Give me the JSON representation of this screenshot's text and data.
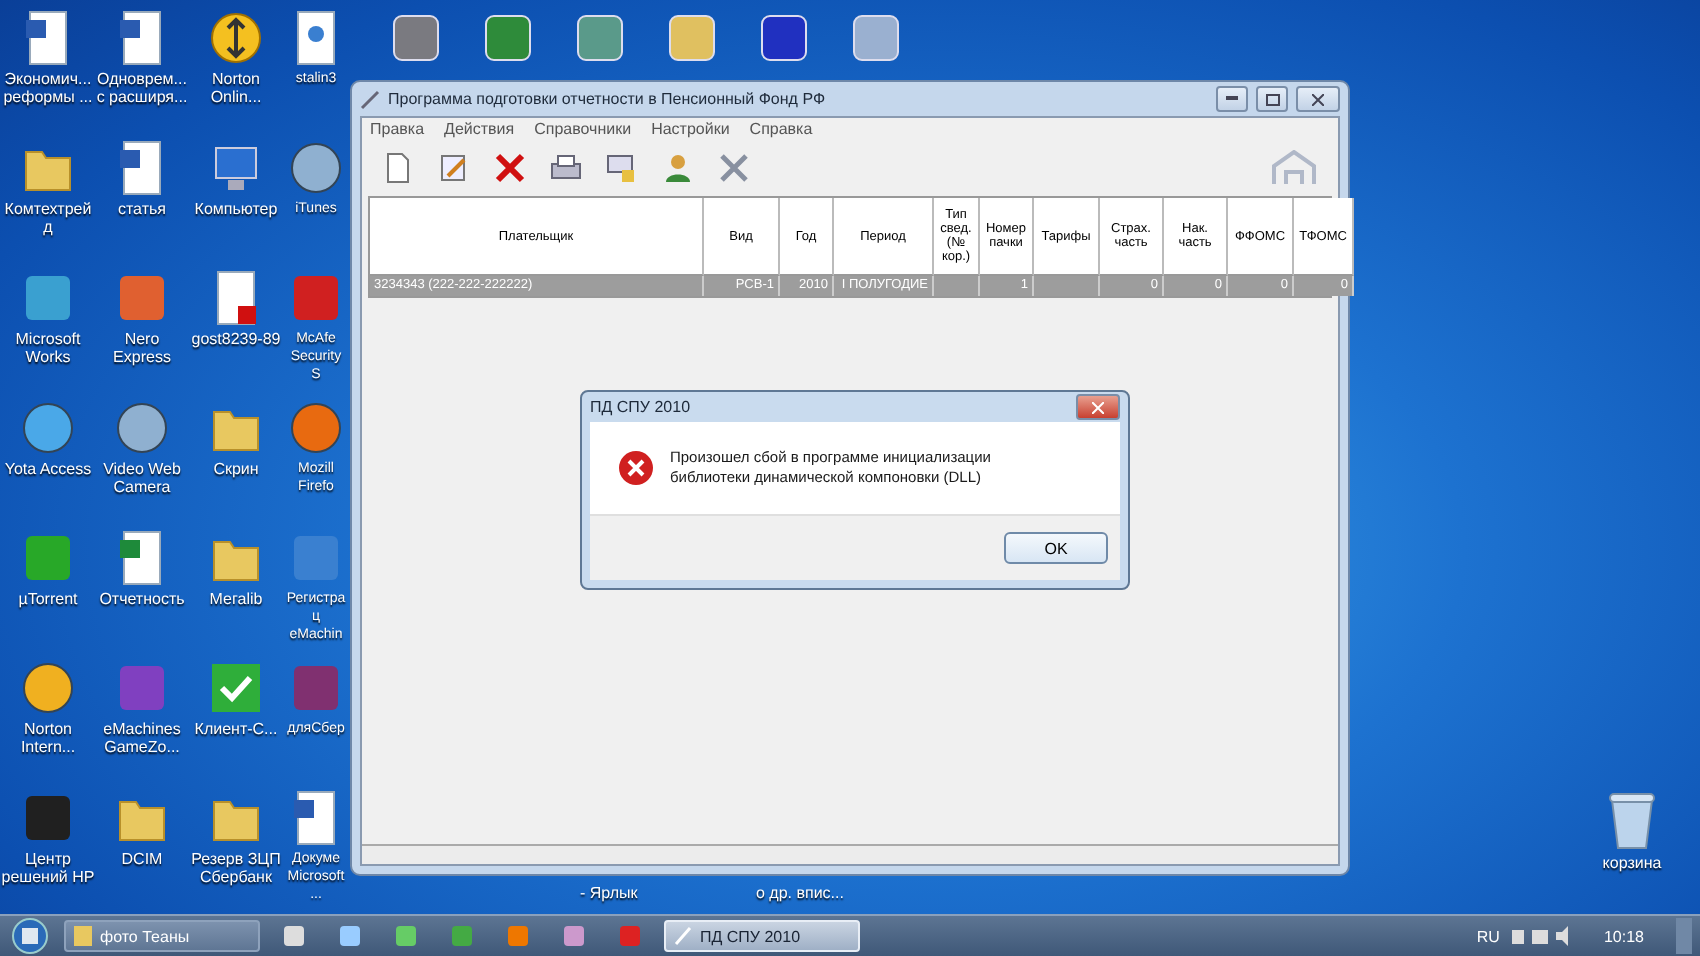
{
  "desktop_icons": [
    {
      "label": "Экономич... реформы ..."
    },
    {
      "label": "Одноврем... с расширя..."
    },
    {
      "label": "Norton Onlin..."
    },
    {
      "label": "stalin3"
    },
    {
      "label": "Комтехтрейд"
    },
    {
      "label": "статья"
    },
    {
      "label": "Компьютер"
    },
    {
      "label": "iTunes"
    },
    {
      "label": "Microsoft Works"
    },
    {
      "label": "Nero Express"
    },
    {
      "label": "gost8239-89"
    },
    {
      "label": "McAfe Security S"
    },
    {
      "label": "Yota Access"
    },
    {
      "label": "Video Web Camera"
    },
    {
      "label": "Скрин"
    },
    {
      "label": "Mozill Firefo"
    },
    {
      "label": "µTorrent"
    },
    {
      "label": "Отчетность"
    },
    {
      "label": "Мегаlib"
    },
    {
      "label": "Регистрац eMachin"
    },
    {
      "label": "Norton Intern..."
    },
    {
      "label": "eMachines GameZo..."
    },
    {
      "label": "Клиент-С..."
    },
    {
      "label": "дляСбер"
    },
    {
      "label": "Центр решений HP"
    },
    {
      "label": "DCIM"
    },
    {
      "label": "Резерв ЗЦП Сбербанк"
    },
    {
      "label": "Докуме Microsoft ..."
    }
  ],
  "hidden_icon_labels": [
    "- Ярлык",
    "о др. впис..."
  ],
  "recycle_bin": {
    "label": "корзина"
  },
  "window": {
    "title": "Программа подготовки отчетности в Пенсионный Фонд РФ",
    "menu": [
      "Правка",
      "Действия",
      "Справочники",
      "Настройки",
      "Справка"
    ],
    "table": {
      "columns": [
        "Плательщик",
        "Вид",
        "Год",
        "Период",
        "Тип свед. (№ кор.)",
        "Номер пачки",
        "Тарифы",
        "Страх. часть",
        "Нак. часть",
        "ФФОМС",
        "ТФОМС"
      ],
      "rows": [
        {
          "selected": true,
          "cells": [
            "3234343 (222-222-222222)",
            "РСВ-1",
            "2010",
            "I ПОЛУГОДИЕ",
            null,
            "1",
            null,
            "0",
            "0",
            "0",
            "0"
          ]
        }
      ]
    }
  },
  "dialog": {
    "title": "ПД СПУ 2010",
    "message": "Произошел сбой в программе инициализации библиотеки динамической компоновки (DLL)",
    "button": "OK"
  },
  "taskbar": {
    "tasks": [
      {
        "label": "фото Теаны",
        "selected": false
      },
      {
        "label": "ПД СПУ 2010",
        "selected": true
      }
    ],
    "language": "RU",
    "time": "10:18"
  }
}
